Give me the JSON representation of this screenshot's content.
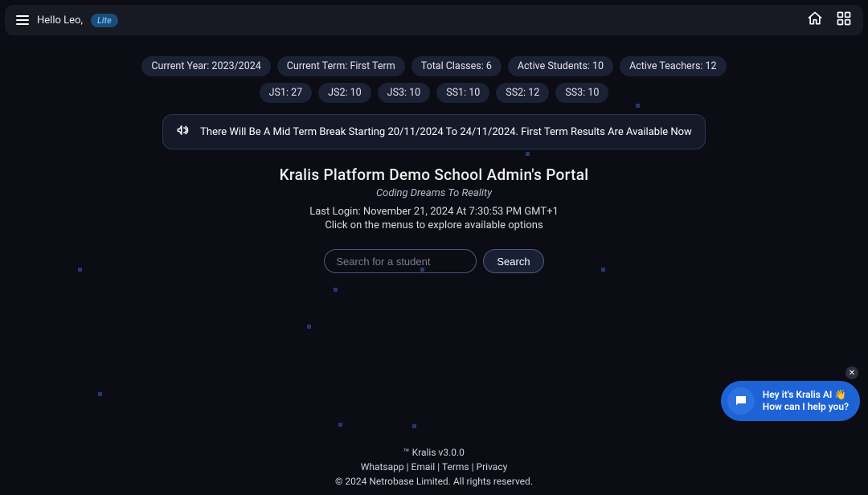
{
  "header": {
    "greeting": "Hello Leo,",
    "badge": "Lite"
  },
  "stats_row": [
    "Current Year: 2023/2024",
    "Current Term: First Term",
    "Total Classes: 6",
    "Active Students: 10",
    "Active Teachers: 12"
  ],
  "class_row": [
    "JS1: 27",
    "JS2: 10",
    "JS3: 10",
    "SS1: 10",
    "SS2: 12",
    "SS3: 10"
  ],
  "announcement": "There Will Be A Mid Term Break Starting 20/11/2024 To 24/11/2024. First Term Results Are Available Now",
  "portal": {
    "title": "Kralis Platform Demo School Admin's Portal",
    "tagline": "Coding Dreams To Reality",
    "last_login": "Last Login: November 21, 2024 At 7:30:53 PM GMT+1",
    "hint": "Click on the menus to explore available options"
  },
  "search": {
    "placeholder": "Search for a student",
    "button": "Search"
  },
  "chat": {
    "line1": "Hey it's Kralis AI 👋",
    "line2": "How can I help you?"
  },
  "footer": {
    "line1": "™ Kralis v3.0.0",
    "links": [
      "Whatsapp",
      "Email",
      "Terms",
      "Privacy"
    ],
    "separator": " | ",
    "line3": "© 2024 Netrobase Limited. All rights reserved."
  }
}
